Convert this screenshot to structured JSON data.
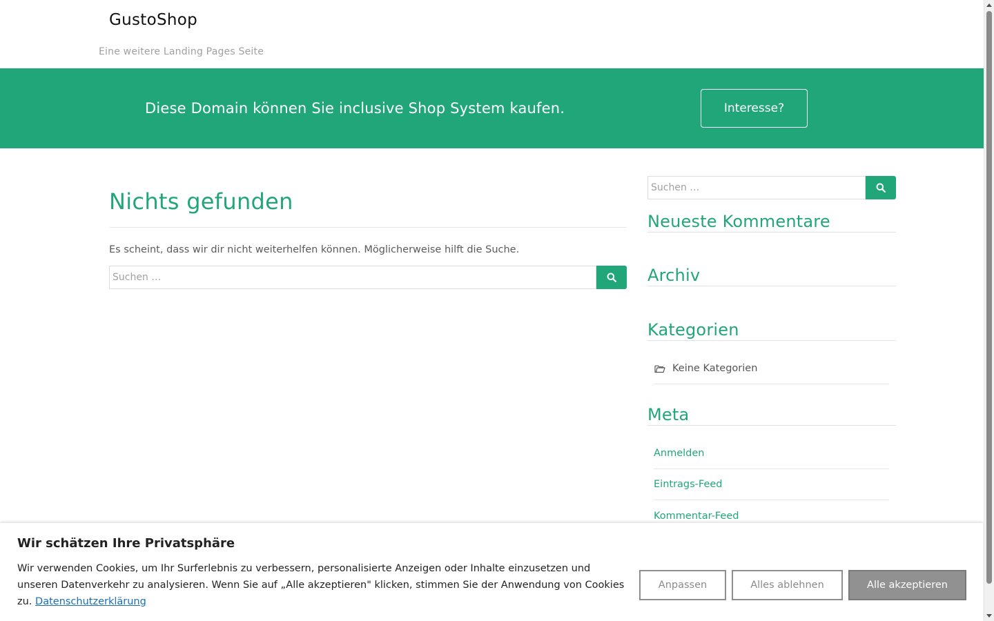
{
  "header": {
    "site_title": "GustoShop",
    "tagline": "Eine weitere Landing Pages Seite"
  },
  "banner": {
    "text": "Diese Domain können Sie inclusive Shop System kaufen.",
    "button_label": "Interesse?",
    "background_color": "#21a67a"
  },
  "main": {
    "title": "Nichts gefunden",
    "message": "Es scheint, dass wir dir nicht weiterhelfen können. Möglicherweise hilft die Suche.",
    "search_placeholder": "Suchen …"
  },
  "sidebar": {
    "search_placeholder": "Suchen …",
    "widgets": {
      "recent_comments": {
        "title": "Neueste Kommentare"
      },
      "archive": {
        "title": "Archiv"
      },
      "categories": {
        "title": "Kategorien",
        "items": [
          "Keine Kategorien"
        ]
      },
      "meta": {
        "title": "Meta",
        "links": [
          "Anmelden",
          "Eintrags-Feed",
          "Kommentar-Feed"
        ]
      }
    }
  },
  "cookie_banner": {
    "title": "Wir schätzen Ihre Privatsphäre",
    "text": "Wir verwenden Cookies, um Ihr Surferlebnis zu verbessern, personalisierte Anzeigen oder Inhalte einzusetzen und unseren Datenverkehr zu analysieren. Wenn Sie auf „Alle akzeptieren\" klicken, stimmen Sie der Anwendung von Cookies zu.",
    "privacy_link": "Datenschutzerklärung",
    "buttons": {
      "customize": "Anpassen",
      "reject_all": "Alles ablehnen",
      "accept_all": "Alle akzeptieren"
    }
  },
  "icons": {
    "search": "search-icon",
    "folder": "folder-icon"
  }
}
